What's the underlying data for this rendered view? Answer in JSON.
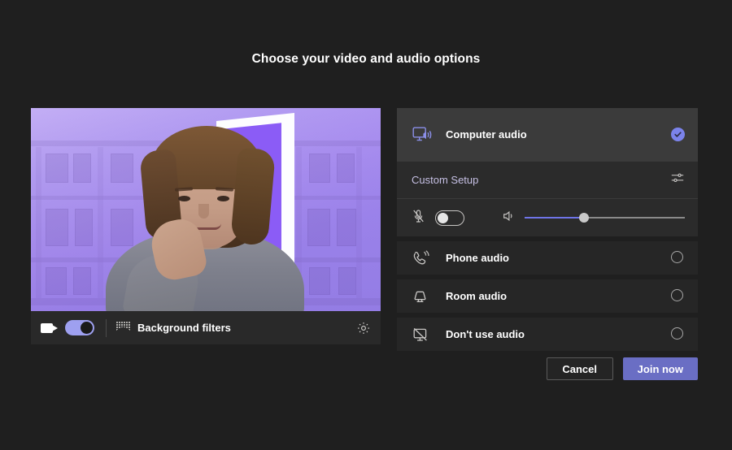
{
  "page": {
    "title": "Choose your video and audio options",
    "background_color": "#1f1f1f",
    "accent_color": "#7b83eb",
    "join_button_color": "#6a6ec4"
  },
  "video_preview": {
    "camera_icon": "video-camera-icon",
    "camera_toggle": {
      "state": "on",
      "label_icon": "video-toggle"
    },
    "background_filters": {
      "icon": "background-filters-icon",
      "label": "Background filters"
    },
    "settings_icon": "gear-icon"
  },
  "audio_options": {
    "selected": "Computer audio",
    "items": [
      {
        "label": "Computer audio",
        "icon": "computer-audio-icon",
        "selected": true,
        "mark": "check-circle-icon"
      },
      {
        "label": "Phone audio",
        "icon": "phone-audio-icon",
        "selected": false,
        "mark": "radio-empty-icon"
      },
      {
        "label": "Room audio",
        "icon": "room-audio-icon",
        "selected": false,
        "mark": "radio-empty-icon"
      },
      {
        "label": "Don't use audio",
        "icon": "no-audio-icon",
        "selected": false,
        "mark": "radio-empty-icon"
      }
    ],
    "custom_setup": {
      "label": "Custom Setup",
      "icon": "sliders-icon"
    },
    "device_controls": {
      "mic_icon": "microphone-muted-icon",
      "mic_toggle_state": "off",
      "speaker_icon": "speaker-icon",
      "volume_percent": 37
    }
  },
  "footer": {
    "cancel_label": "Cancel",
    "join_label": "Join now"
  }
}
